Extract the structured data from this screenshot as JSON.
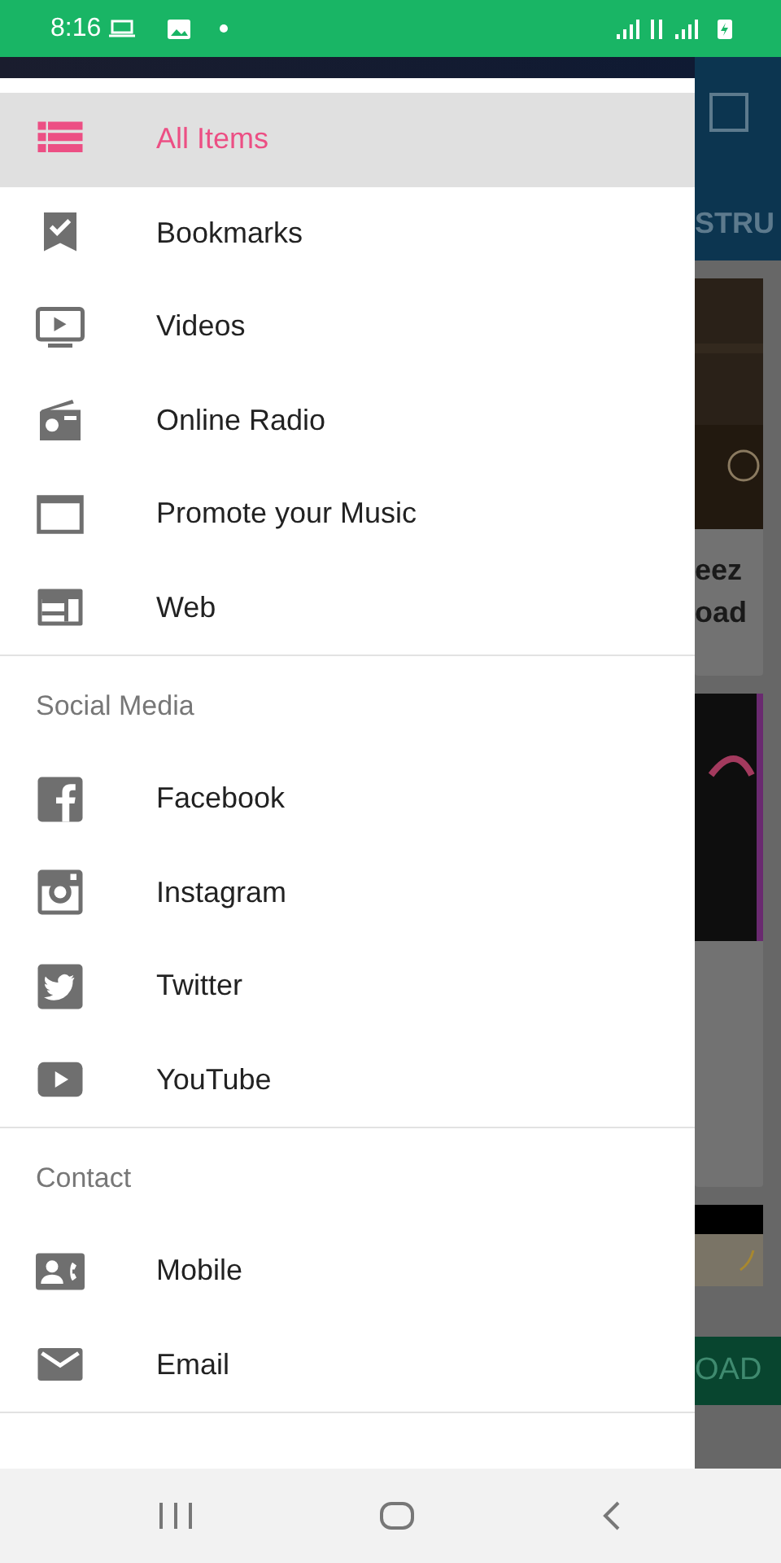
{
  "status_bar": {
    "time": "8:16"
  },
  "drawer": {
    "sections": [
      {
        "items": [
          {
            "label": "All Items",
            "selected": true
          },
          {
            "label": "Bookmarks",
            "selected": false
          },
          {
            "label": "Videos",
            "selected": false
          },
          {
            "label": "Online Radio",
            "selected": false
          },
          {
            "label": "Promote your Music",
            "selected": false
          },
          {
            "label": "Web",
            "selected": false
          }
        ]
      },
      {
        "header": "Social Media",
        "items": [
          {
            "label": "Facebook",
            "selected": false
          },
          {
            "label": "Instagram",
            "selected": false
          },
          {
            "label": "Twitter",
            "selected": false
          },
          {
            "label": "YouTube",
            "selected": false
          }
        ]
      },
      {
        "header": "Contact",
        "items": [
          {
            "label": "Mobile",
            "selected": false
          },
          {
            "label": "Email",
            "selected": false
          }
        ]
      }
    ]
  },
  "background": {
    "tab_label": "STRU",
    "card_title": [
      "eez",
      "oad"
    ],
    "button_label": "OAD"
  }
}
